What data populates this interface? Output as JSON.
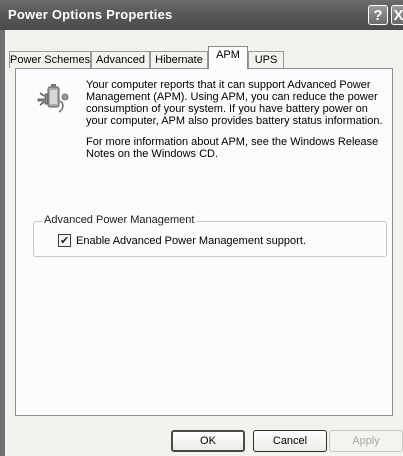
{
  "window": {
    "title": "Power Options Properties",
    "help_label": "?",
    "close_label": "X"
  },
  "tabs": [
    {
      "label": "Power Schemes",
      "active": false
    },
    {
      "label": "Advanced",
      "active": false
    },
    {
      "label": "Hibernate",
      "active": false
    },
    {
      "label": "APM",
      "active": true
    },
    {
      "label": "UPS",
      "active": false
    }
  ],
  "apm": {
    "icon": "battery-plug-icon",
    "paragraph1": "Your computer reports that it can support Advanced Power Management (APM).  Using APM, you can reduce the power consumption of your system.  If you have battery power on your computer, APM also provides battery status information.",
    "paragraph2": "For more information about APM, see the Windows Release Notes on the Windows CD.",
    "group_title": "Advanced Power Management",
    "checkbox_label": "Enable Advanced Power Management support.",
    "checkbox_checked": true
  },
  "buttons": {
    "ok": "OK",
    "cancel": "Cancel",
    "apply": "Apply"
  }
}
